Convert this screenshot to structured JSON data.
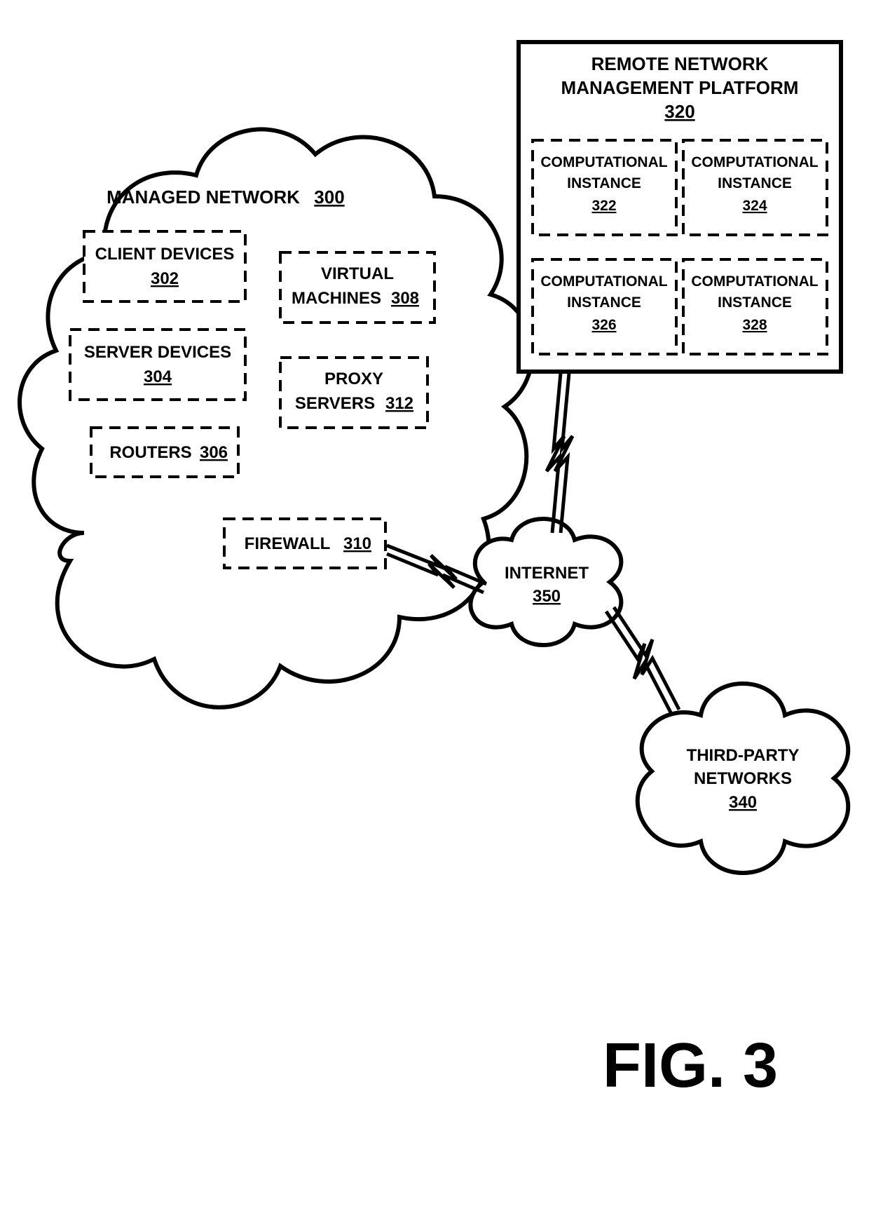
{
  "figure_label": "FIG. 3",
  "managed_network": {
    "title_line1": "MANAGED NETWORK",
    "title_ref": "300",
    "client_devices": {
      "label": "CLIENT DEVICES",
      "ref": "302"
    },
    "server_devices": {
      "label": "SERVER DEVICES",
      "ref": "304"
    },
    "routers": {
      "label": "ROUTERS",
      "ref": "306"
    },
    "virtual_machines": {
      "line1": "VIRTUAL",
      "line2": "MACHINES",
      "ref": "308"
    },
    "proxy_servers": {
      "line1": "PROXY",
      "line2": "SERVERS",
      "ref": "312"
    },
    "firewall": {
      "label": "FIREWALL",
      "ref": "310"
    }
  },
  "internet": {
    "label": "INTERNET",
    "ref": "350"
  },
  "remote_platform": {
    "title_line1": "REMOTE NETWORK",
    "title_line2": "MANAGEMENT PLATFORM",
    "title_ref": "320",
    "ci322": {
      "line1": "COMPUTATIONAL",
      "line2": "INSTANCE",
      "ref": "322"
    },
    "ci324": {
      "line1": "COMPUTATIONAL",
      "line2": "INSTANCE",
      "ref": "324"
    },
    "ci326": {
      "line1": "COMPUTATIONAL",
      "line2": "INSTANCE",
      "ref": "326"
    },
    "ci328": {
      "line1": "COMPUTATIONAL",
      "line2": "INSTANCE",
      "ref": "328"
    }
  },
  "third_party": {
    "line1": "THIRD-PARTY",
    "line2": "NETWORKS",
    "ref": "340"
  }
}
